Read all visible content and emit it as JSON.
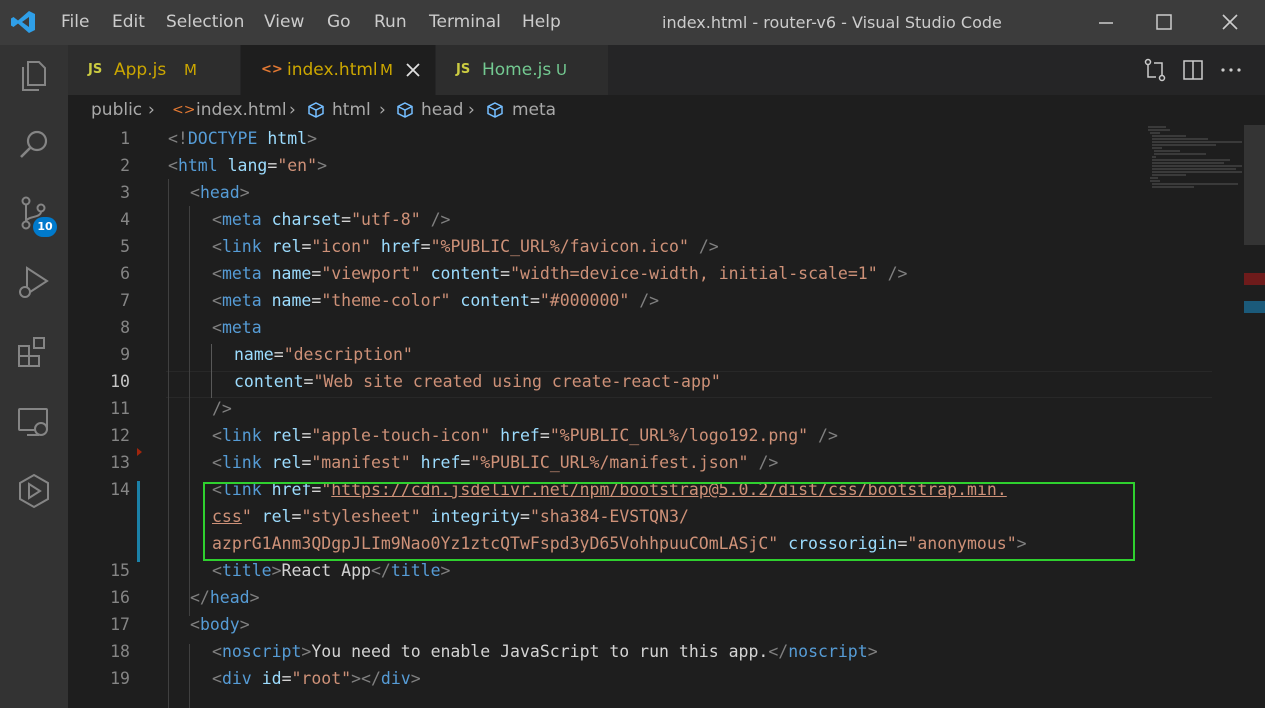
{
  "window": {
    "title": "index.html - router-v6 - Visual Studio Code",
    "menu": [
      "File",
      "Edit",
      "Selection",
      "View",
      "Go",
      "Run",
      "Terminal",
      "Help"
    ]
  },
  "activity_bar": {
    "icons": [
      "explorer-icon",
      "search-icon",
      "source-control-icon",
      "run-debug-icon",
      "extensions-icon",
      "remote-explorer-icon",
      "live-share-icon"
    ],
    "source_control_badge": "10"
  },
  "tabs": [
    {
      "icon": "JS",
      "label": "App.js",
      "status": "M",
      "color": "#cccccc"
    },
    {
      "icon": "<>",
      "label": "index.html",
      "status": "M",
      "color": "#cccccc",
      "active": true
    },
    {
      "icon": "JS",
      "label": "Home.js",
      "status": "U",
      "color": "#73c991"
    }
  ],
  "breadcrumb": [
    "public",
    "index.html",
    "html",
    "head",
    "meta"
  ],
  "editor": {
    "current_line": "10",
    "line_numbers": [
      "1",
      "2",
      "3",
      "4",
      "5",
      "6",
      "7",
      "8",
      "9",
      "10",
      "11",
      "12",
      "13",
      "14",
      "15",
      "16",
      "17",
      "18",
      "19"
    ],
    "lines": [
      [
        [
          "br",
          "<!"
        ],
        [
          "tag",
          "DOCTYPE"
        ],
        [
          "txt",
          " "
        ],
        [
          "attr",
          "html"
        ],
        [
          "br",
          ">"
        ]
      ],
      [
        [
          "br",
          "<"
        ],
        [
          "tag",
          "html"
        ],
        [
          "txt",
          " "
        ],
        [
          "attr",
          "lang"
        ],
        [
          "txt",
          "="
        ],
        [
          "str",
          "\"en\""
        ],
        [
          "br",
          ">"
        ]
      ],
      [
        [
          "br",
          "<"
        ],
        [
          "tag",
          "head"
        ],
        [
          "br",
          ">"
        ]
      ],
      [
        [
          "br",
          "<"
        ],
        [
          "tag",
          "meta"
        ],
        [
          "txt",
          " "
        ],
        [
          "attr",
          "charset"
        ],
        [
          "txt",
          "="
        ],
        [
          "str",
          "\"utf-8\""
        ],
        [
          "txt",
          " "
        ],
        [
          "br",
          "/>"
        ]
      ],
      [
        [
          "br",
          "<"
        ],
        [
          "tag",
          "link"
        ],
        [
          "txt",
          " "
        ],
        [
          "attr",
          "rel"
        ],
        [
          "txt",
          "="
        ],
        [
          "str",
          "\"icon\""
        ],
        [
          "txt",
          " "
        ],
        [
          "attr",
          "href"
        ],
        [
          "txt",
          "="
        ],
        [
          "str",
          "\"%PUBLIC_URL%/favicon.ico\""
        ],
        [
          "txt",
          " "
        ],
        [
          "br",
          "/>"
        ]
      ],
      [
        [
          "br",
          "<"
        ],
        [
          "tag",
          "meta"
        ],
        [
          "txt",
          " "
        ],
        [
          "attr",
          "name"
        ],
        [
          "txt",
          "="
        ],
        [
          "str",
          "\"viewport\""
        ],
        [
          "txt",
          " "
        ],
        [
          "attr",
          "content"
        ],
        [
          "txt",
          "="
        ],
        [
          "str",
          "\"width=device-width, initial-scale=1\""
        ],
        [
          "txt",
          " "
        ],
        [
          "br",
          "/>"
        ]
      ],
      [
        [
          "br",
          "<"
        ],
        [
          "tag",
          "meta"
        ],
        [
          "txt",
          " "
        ],
        [
          "attr",
          "name"
        ],
        [
          "txt",
          "="
        ],
        [
          "str",
          "\"theme-color\""
        ],
        [
          "txt",
          " "
        ],
        [
          "attr",
          "content"
        ],
        [
          "txt",
          "="
        ],
        [
          "str",
          "\"#000000\""
        ],
        [
          "txt",
          " "
        ],
        [
          "br",
          "/>"
        ]
      ],
      [
        [
          "br",
          "<"
        ],
        [
          "tag",
          "meta"
        ]
      ],
      [
        [
          "attr",
          "name"
        ],
        [
          "txt",
          "="
        ],
        [
          "str",
          "\"description\""
        ]
      ],
      [
        [
          "attr",
          "content"
        ],
        [
          "txt",
          "="
        ],
        [
          "str",
          "\"Web site created using create-react-app\""
        ]
      ],
      [
        [
          "br",
          "/>"
        ]
      ],
      [
        [
          "br",
          "<"
        ],
        [
          "tag",
          "link"
        ],
        [
          "txt",
          " "
        ],
        [
          "attr",
          "rel"
        ],
        [
          "txt",
          "="
        ],
        [
          "str",
          "\"apple-touch-icon\""
        ],
        [
          "txt",
          " "
        ],
        [
          "attr",
          "href"
        ],
        [
          "txt",
          "="
        ],
        [
          "str",
          "\"%PUBLIC_URL%/logo192.png\""
        ],
        [
          "txt",
          " "
        ],
        [
          "br",
          "/>"
        ]
      ],
      [
        [
          "br",
          "<"
        ],
        [
          "tag",
          "link"
        ],
        [
          "txt",
          " "
        ],
        [
          "attr",
          "rel"
        ],
        [
          "txt",
          "="
        ],
        [
          "str",
          "\"manifest\""
        ],
        [
          "txt",
          " "
        ],
        [
          "attr",
          "href"
        ],
        [
          "txt",
          "="
        ],
        [
          "str",
          "\"%PUBLIC_URL%/manifest.json\""
        ],
        [
          "txt",
          " "
        ],
        [
          "br",
          "/>"
        ]
      ],
      [
        [
          "br",
          "<"
        ],
        [
          "tag",
          "link"
        ],
        [
          "txt",
          " "
        ],
        [
          "attr",
          "href"
        ],
        [
          "txt",
          "="
        ],
        [
          "str",
          "\""
        ],
        [
          "stru",
          "https://cdn.jsdelivr.net/npm/bootstrap@5.0.2/dist/css/bootstrap.min."
        ]
      ],
      [
        [
          "stru",
          "css"
        ],
        [
          "str",
          "\""
        ],
        [
          "txt",
          " "
        ],
        [
          "attr",
          "rel"
        ],
        [
          "txt",
          "="
        ],
        [
          "str",
          "\"stylesheet\""
        ],
        [
          "txt",
          " "
        ],
        [
          "attr",
          "integrity"
        ],
        [
          "txt",
          "="
        ],
        [
          "str",
          "\"sha384-EVSTQN3/"
        ]
      ],
      [
        [
          "str",
          "azprG1Anm3QDgpJLIm9Nao0Yz1ztcQTwFspd3yD65VohhpuuCOmLASjC\""
        ],
        [
          "txt",
          " "
        ],
        [
          "attr",
          "crossorigin"
        ],
        [
          "txt",
          "="
        ],
        [
          "str",
          "\"anonymous\""
        ],
        [
          "br",
          ">"
        ]
      ],
      [
        [
          "br",
          "<"
        ],
        [
          "tag",
          "title"
        ],
        [
          "br",
          ">"
        ],
        [
          "txt",
          "React App"
        ],
        [
          "br",
          "</"
        ],
        [
          "tag",
          "title"
        ],
        [
          "br",
          ">"
        ]
      ],
      [
        [
          "br",
          "</"
        ],
        [
          "tag",
          "head"
        ],
        [
          "br",
          ">"
        ]
      ],
      [
        [
          "br",
          "<"
        ],
        [
          "tag",
          "body"
        ],
        [
          "br",
          ">"
        ]
      ],
      [
        [
          "br",
          "<"
        ],
        [
          "tag",
          "noscript"
        ],
        [
          "br",
          ">"
        ],
        [
          "txt",
          "You need to enable JavaScript to run this app."
        ],
        [
          "br",
          "</"
        ],
        [
          "tag",
          "noscript"
        ],
        [
          "br",
          ">"
        ]
      ],
      [
        [
          "br",
          "<"
        ],
        [
          "tag",
          "div"
        ],
        [
          "txt",
          " "
        ],
        [
          "attr",
          "id"
        ],
        [
          "txt",
          "="
        ],
        [
          "str",
          "\"root\""
        ],
        [
          "br",
          "></"
        ],
        [
          "tag",
          "div"
        ],
        [
          "br",
          ">"
        ]
      ]
    ]
  }
}
